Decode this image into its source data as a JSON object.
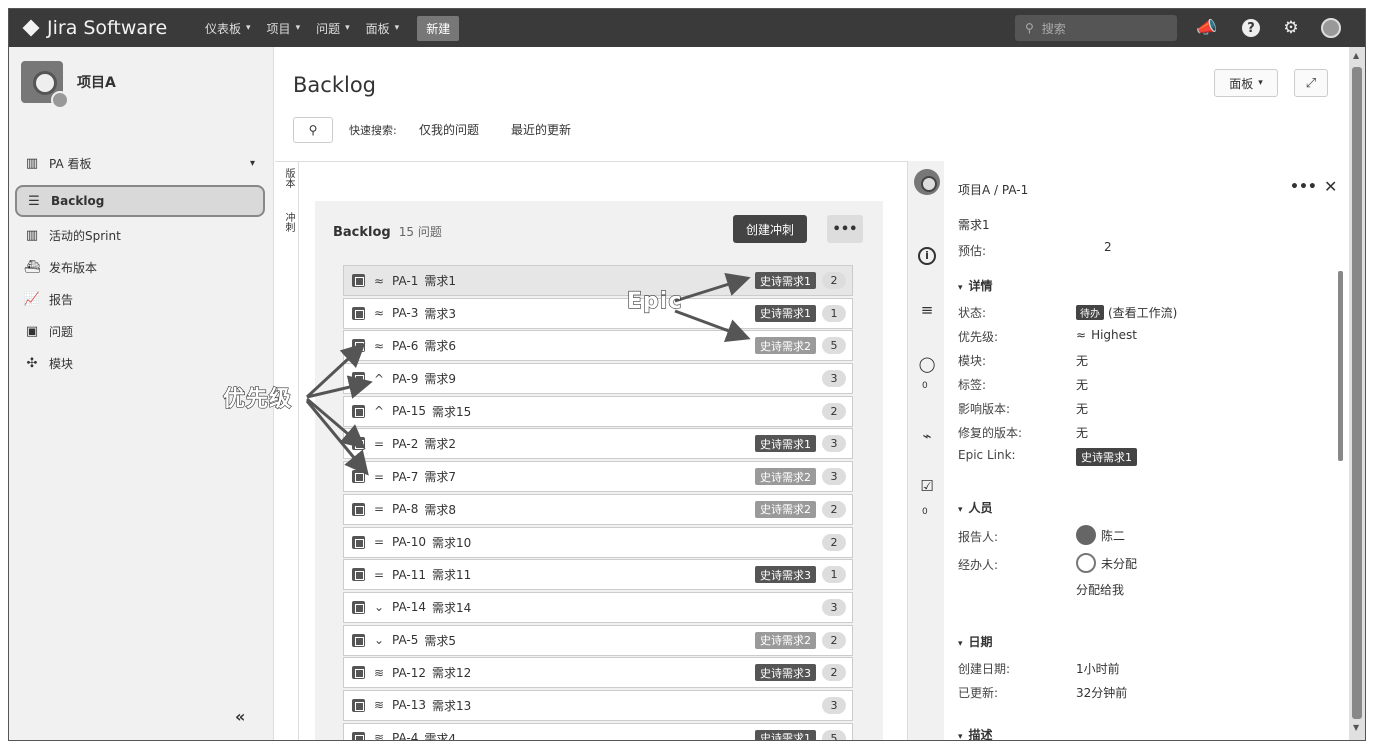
{
  "topnav": {
    "logo": "Jira Software",
    "menus": [
      {
        "label": "仪表板"
      },
      {
        "label": "项目"
      },
      {
        "label": "问题"
      },
      {
        "label": "面板"
      }
    ],
    "create": "新建",
    "search_placeholder": "搜索"
  },
  "sidebar": {
    "project_name": "项目A",
    "board_label": "PA 看板",
    "items": [
      {
        "key": "backlog",
        "label": "Backlog",
        "icon": "backlog-icon"
      },
      {
        "key": "active-sprint",
        "label": "活动的Sprint",
        "icon": "board-columns-icon"
      },
      {
        "key": "releases",
        "label": "发布版本",
        "icon": "ship-icon"
      },
      {
        "key": "reports",
        "label": "报告",
        "icon": "chart-icon"
      },
      {
        "key": "issues",
        "label": "问题",
        "icon": "issues-icon"
      },
      {
        "key": "components",
        "label": "模块",
        "icon": "puzzle-icon"
      }
    ],
    "collapse": "«"
  },
  "main": {
    "title": "Backlog",
    "quick_search_label": "快速搜索:",
    "quick_filters": [
      "仅我的问题",
      "最近的更新"
    ],
    "vtabs": [
      "版本",
      "冲刺"
    ],
    "board_button": "面板",
    "backlog": {
      "title": "Backlog",
      "count": "15 问题",
      "create_sprint": "创建冲刺",
      "more": "•••"
    },
    "issues": [
      {
        "key": "PA-1",
        "summary": "需求1",
        "priority": "highest",
        "epic": "史诗需求1",
        "epic_color": "#555555",
        "estimate": "2"
      },
      {
        "key": "PA-3",
        "summary": "需求3",
        "priority": "highest",
        "epic": "史诗需求1",
        "epic_color": "#555555",
        "estimate": "1"
      },
      {
        "key": "PA-6",
        "summary": "需求6",
        "priority": "highest",
        "epic": "史诗需求2",
        "epic_color": "#9a9a9a",
        "estimate": "5"
      },
      {
        "key": "PA-9",
        "summary": "需求9",
        "priority": "high",
        "epic": "",
        "epic_color": "",
        "estimate": "3"
      },
      {
        "key": "PA-15",
        "summary": "需求15",
        "priority": "high",
        "epic": "",
        "epic_color": "",
        "estimate": "2"
      },
      {
        "key": "PA-2",
        "summary": "需求2",
        "priority": "medium",
        "epic": "史诗需求1",
        "epic_color": "#555555",
        "estimate": "3"
      },
      {
        "key": "PA-7",
        "summary": "需求7",
        "priority": "medium",
        "epic": "史诗需求2",
        "epic_color": "#9a9a9a",
        "estimate": "3"
      },
      {
        "key": "PA-8",
        "summary": "需求8",
        "priority": "medium",
        "epic": "史诗需求2",
        "epic_color": "#9a9a9a",
        "estimate": "2"
      },
      {
        "key": "PA-10",
        "summary": "需求10",
        "priority": "medium",
        "epic": "",
        "epic_color": "",
        "estimate": "2"
      },
      {
        "key": "PA-11",
        "summary": "需求11",
        "priority": "medium",
        "epic": "史诗需求3",
        "epic_color": "#555555",
        "estimate": "1"
      },
      {
        "key": "PA-14",
        "summary": "需求14",
        "priority": "low",
        "epic": "",
        "epic_color": "",
        "estimate": "3"
      },
      {
        "key": "PA-5",
        "summary": "需求5",
        "priority": "low",
        "epic": "史诗需求2",
        "epic_color": "#9a9a9a",
        "estimate": "2"
      },
      {
        "key": "PA-12",
        "summary": "需求12",
        "priority": "lowest",
        "epic": "史诗需求3",
        "epic_color": "#555555",
        "estimate": "2"
      },
      {
        "key": "PA-13",
        "summary": "需求13",
        "priority": "lowest",
        "epic": "",
        "epic_color": "",
        "estimate": "3"
      },
      {
        "key": "PA-4",
        "summary": "需求4",
        "priority": "lowest",
        "epic": "史诗需求1",
        "epic_color": "#555555",
        "estimate": "5"
      }
    ],
    "priority_glyphs": {
      "highest": "≈",
      "high": "^",
      "medium": "=",
      "low": "⌄",
      "lowest": "≋"
    }
  },
  "detail": {
    "breadcrumb": "项目A / PA-1",
    "summary": "需求1",
    "estimate_label": "预估:",
    "estimate_value": "2",
    "sections": {
      "details": "详情",
      "people": "人员",
      "dates": "日期",
      "description": "描述"
    },
    "fields": [
      {
        "label": "状态:",
        "value": "(查看工作流)",
        "badge": "待办"
      },
      {
        "label": "优先级:",
        "value": "Highest",
        "glyph": "≈"
      },
      {
        "label": "模块:",
        "value": "无"
      },
      {
        "label": "标签:",
        "value": "无"
      },
      {
        "label": "影响版本:",
        "value": "无"
      },
      {
        "label": "修复的版本:",
        "value": "无"
      },
      {
        "label": "Epic Link:",
        "value": "史诗需求1"
      }
    ],
    "people": {
      "reporter_label": "报告人:",
      "reporter": "陈二",
      "assignee_label": "经办人:",
      "assignee": "未分配",
      "assign_me": "分配给我"
    },
    "dates": {
      "created_label": "创建日期:",
      "created": "1小时前",
      "updated_label": "已更新:",
      "updated": "32分钟前"
    },
    "icon_counts": {
      "comments": "0",
      "subtasks": "0"
    }
  },
  "annotations": {
    "epic": "Epic",
    "priority": "优先级"
  }
}
